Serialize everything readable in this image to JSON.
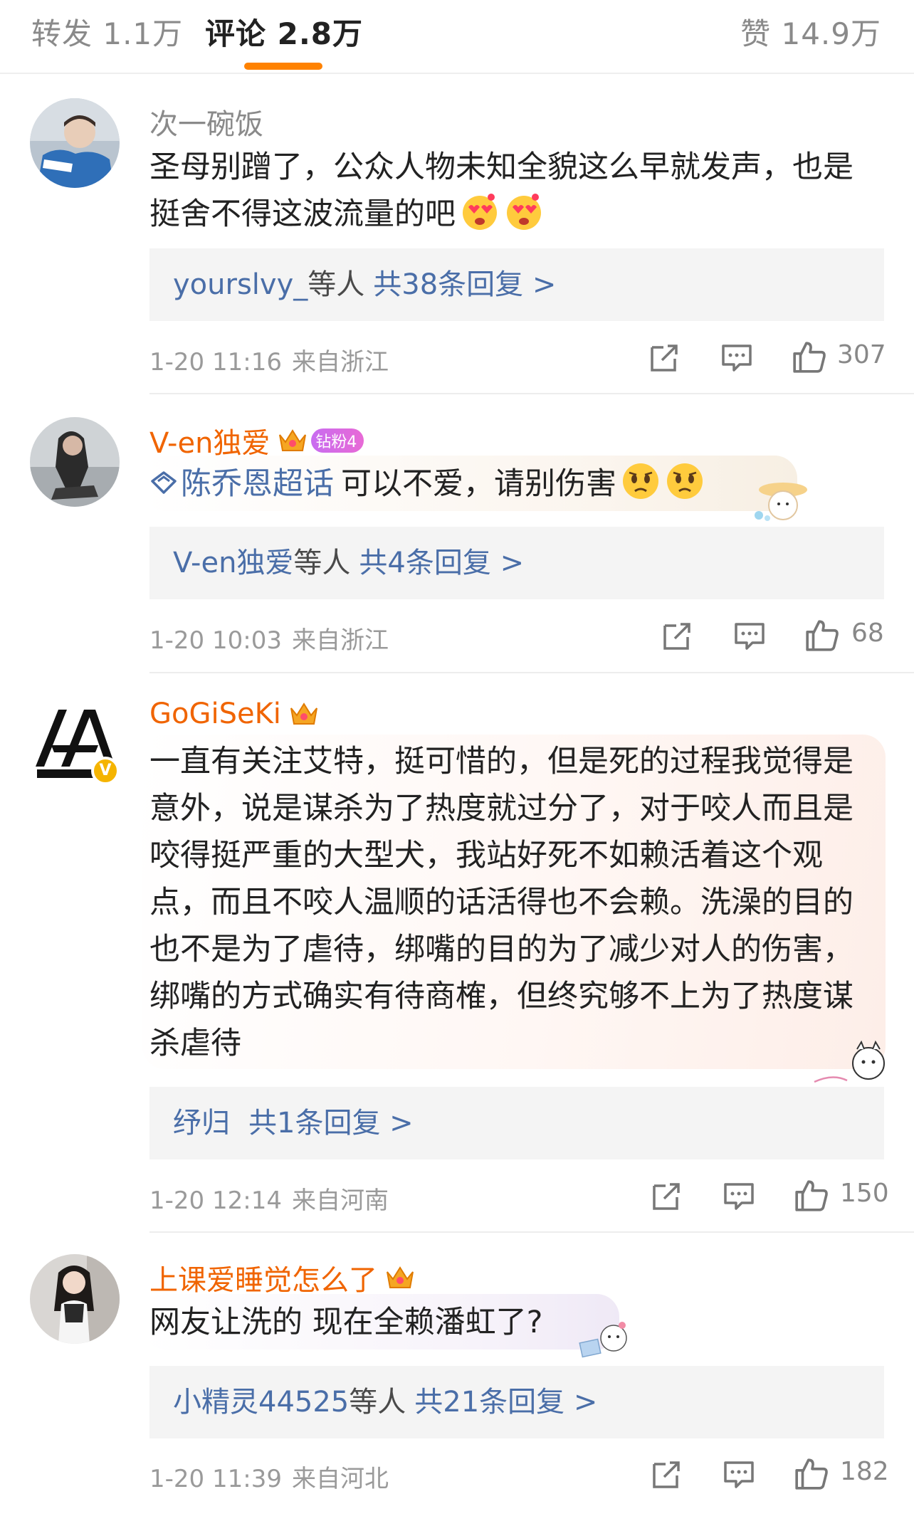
{
  "tabs": {
    "forward": "转发 1.1万",
    "comments": "评论 2.8万",
    "likes": "赞 14.9万"
  },
  "colors": {
    "accent": "#ff8200",
    "link": "#4a6ea8",
    "vip_name": "#f06400",
    "reply_bg": "#f4f4f4"
  },
  "comments": [
    {
      "username": "次一碗饭",
      "text": "圣母别蹭了，公众人物未知全貌这么早就发声，也是挺舍不得这波流量的吧",
      "emojis": [
        "heart-eyes-emoji",
        "heart-eyes-emoji"
      ],
      "reply_names": "yourslvy_",
      "reply_etc": "等人",
      "reply_count": "共38条回复 >",
      "time": "1-20 11:16",
      "location": "来自浙江",
      "likes": "307"
    },
    {
      "username": "V-en独爱",
      "badge": "钻粉4",
      "topic": "陈乔恩超话",
      "text": "可以不爱，请别伤害",
      "emojis": [
        "sad-emoji",
        "sad-emoji"
      ],
      "reply_names": "V-en独爱",
      "reply_etc": "等人",
      "reply_count": "共4条回复 >",
      "time": "1-20 10:03",
      "location": "来自浙江",
      "likes": "68"
    },
    {
      "username": "GoGiSeKi",
      "text": "一直有关注艾特，挺可惜的，但是死的过程我觉得是意外，说是谋杀为了热度就过分了，对于咬人而且是咬得挺严重的大型犬，我站好死不如赖活着这个观点，而且不咬人温顺的话活得也不会赖。洗澡的目的也不是为了虐待，绑嘴的目的为了减少对人的伤害，绑嘴的方式确实有待商榷，但终究够不上为了热度谋杀虐待",
      "reply_names": "纾归",
      "reply_etc": "",
      "reply_count": "共1条回复 >",
      "time": "1-20 12:14",
      "location": "来自河南",
      "likes": "150"
    },
    {
      "username": "上课爱睡觉怎么了",
      "text": "网友让洗的 现在全赖潘虹了?",
      "reply_names": "小精灵44525",
      "reply_etc": "等人",
      "reply_count": "共21条回复 >",
      "time": "1-20 11:39",
      "location": "来自河北",
      "likes": "182"
    }
  ]
}
